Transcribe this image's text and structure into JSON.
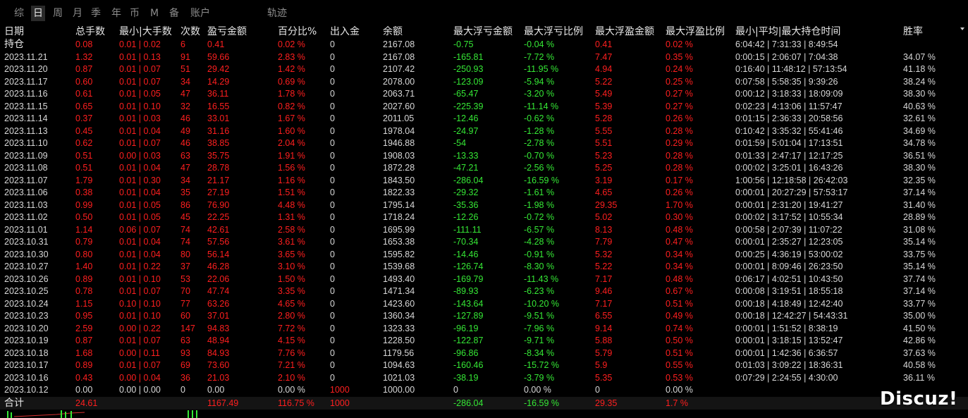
{
  "tabs": [
    {
      "label": "综"
    },
    {
      "label": "日"
    },
    {
      "label": "周"
    },
    {
      "label": "月"
    },
    {
      "label": "季"
    },
    {
      "label": "年"
    },
    {
      "label": "币"
    },
    {
      "label": "M"
    },
    {
      "label": "备"
    },
    {
      "label": "账户"
    },
    {
      "label": "轨迹"
    }
  ],
  "active_tab": "日",
  "columns": [
    "日期",
    "总手数",
    "最小|大手数",
    "次数",
    "盈亏金额",
    "百分比%",
    "出入金",
    "余额",
    "最大浮亏金额",
    "最大浮亏比例",
    "最大浮盈金额",
    "最大浮盈比例",
    "最小|平均|最大持仓时间",
    "胜率"
  ],
  "colors": {
    "positive": "#ff1f1f",
    "negative": "#35e835",
    "neutral": "#d8d8d8",
    "background": "#000000"
  },
  "rows": [
    [
      "持仓",
      "0.08",
      "0.01 | 0.02",
      "6",
      "0.41",
      "0.02 %",
      "0",
      "2167.08",
      "-0.75",
      "-0.04 %",
      "0.41",
      "0.02 %",
      "6:04:42 | 7:31:33 | 8:49:54",
      ""
    ],
    [
      "2023.11.21",
      "1.32",
      "0.01 | 0.13",
      "91",
      "59.66",
      "2.83 %",
      "0",
      "2167.08",
      "-165.81",
      "-7.72 %",
      "7.47",
      "0.35 %",
      "0:00:15 | 2:06:07 | 7:04:38",
      "34.07 %"
    ],
    [
      "2023.11.20",
      "0.87",
      "0.01 | 0.07",
      "51",
      "29.42",
      "1.42 %",
      "0",
      "2107.42",
      "-250.93",
      "-11.95 %",
      "4.94",
      "0.24 %",
      "0:16:40 | 11:48:12 | 57:13:54",
      "41.18 %"
    ],
    [
      "2023.11.17",
      "0.60",
      "0.01 | 0.07",
      "34",
      "14.29",
      "0.69 %",
      "0",
      "2078.00",
      "-123.09",
      "-5.94 %",
      "5.22",
      "0.25 %",
      "0:07:58 | 5:58:35 | 9:39:26",
      "38.24 %"
    ],
    [
      "2023.11.16",
      "0.61",
      "0.01 | 0.05",
      "47",
      "36.11",
      "1.78 %",
      "0",
      "2063.71",
      "-65.47",
      "-3.20 %",
      "5.49",
      "0.27 %",
      "0:00:12 | 3:18:33 | 18:09:09",
      "38.30 %"
    ],
    [
      "2023.11.15",
      "0.65",
      "0.01 | 0.10",
      "32",
      "16.55",
      "0.82 %",
      "0",
      "2027.60",
      "-225.39",
      "-11.14 %",
      "5.39",
      "0.27 %",
      "0:02:23 | 4:13:06 | 11:57:47",
      "40.63 %"
    ],
    [
      "2023.11.14",
      "0.37",
      "0.01 | 0.03",
      "46",
      "33.01",
      "1.67 %",
      "0",
      "2011.05",
      "-12.46",
      "-0.62 %",
      "5.28",
      "0.26 %",
      "0:01:15 | 2:36:33 | 20:58:56",
      "32.61 %"
    ],
    [
      "2023.11.13",
      "0.45",
      "0.01 | 0.04",
      "49",
      "31.16",
      "1.60 %",
      "0",
      "1978.04",
      "-24.97",
      "-1.28 %",
      "5.55",
      "0.28 %",
      "0:10:42 | 3:35:32 | 55:41:46",
      "34.69 %"
    ],
    [
      "2023.11.10",
      "0.62",
      "0.01 | 0.07",
      "46",
      "38.85",
      "2.04 %",
      "0",
      "1946.88",
      "-54",
      "-2.78 %",
      "5.51",
      "0.29 %",
      "0:01:59 | 5:01:04 | 17:13:51",
      "34.78 %"
    ],
    [
      "2023.11.09",
      "0.51",
      "0.00 | 0.03",
      "63",
      "35.75",
      "1.91 %",
      "0",
      "1908.03",
      "-13.33",
      "-0.70 %",
      "5.23",
      "0.28 %",
      "0:01:33 | 2:47:17 | 12:17:25",
      "36.51 %"
    ],
    [
      "2023.11.08",
      "0.51",
      "0.01 | 0.04",
      "47",
      "28.78",
      "1.56 %",
      "0",
      "1872.28",
      "-47.21",
      "-2.56 %",
      "5.25",
      "0.28 %",
      "0:00:02 | 3:25:01 | 16:43:26",
      "38.30 %"
    ],
    [
      "2023.11.07",
      "1.79",
      "0.01 | 0.30",
      "34",
      "21.17",
      "1.16 %",
      "0",
      "1843.50",
      "-286.04",
      "-16.59 %",
      "3.19",
      "0.17 %",
      "1:00:56 | 12:18:58 | 26:42:03",
      "32.35 %"
    ],
    [
      "2023.11.06",
      "0.38",
      "0.01 | 0.04",
      "35",
      "27.19",
      "1.51 %",
      "0",
      "1822.33",
      "-29.32",
      "-1.61 %",
      "4.65",
      "0.26 %",
      "0:00:01 | 20:27:29 | 57:53:17",
      "37.14 %"
    ],
    [
      "2023.11.03",
      "0.99",
      "0.01 | 0.05",
      "86",
      "76.90",
      "4.48 %",
      "0",
      "1795.14",
      "-35.36",
      "-1.98 %",
      "29.35",
      "1.70 %",
      "0:00:01 | 2:31:20 | 19:41:27",
      "31.40 %"
    ],
    [
      "2023.11.02",
      "0.50",
      "0.01 | 0.05",
      "45",
      "22.25",
      "1.31 %",
      "0",
      "1718.24",
      "-12.26",
      "-0.72 %",
      "5.02",
      "0.30 %",
      "0:00:02 | 3:17:52 | 10:55:34",
      "28.89 %"
    ],
    [
      "2023.11.01",
      "1.14",
      "0.06 | 0.07",
      "74",
      "42.61",
      "2.58 %",
      "0",
      "1695.99",
      "-111.11",
      "-6.57 %",
      "8.13",
      "0.48 %",
      "0:00:58 | 2:07:39 | 11:07:22",
      "31.08 %"
    ],
    [
      "2023.10.31",
      "0.79",
      "0.01 | 0.04",
      "74",
      "57.56",
      "3.61 %",
      "0",
      "1653.38",
      "-70.34",
      "-4.28 %",
      "7.79",
      "0.47 %",
      "0:00:01 | 2:35:27 | 12:23:05",
      "35.14 %"
    ],
    [
      "2023.10.30",
      "0.80",
      "0.01 | 0.04",
      "80",
      "56.14",
      "3.65 %",
      "0",
      "1595.82",
      "-14.46",
      "-0.91 %",
      "5.32",
      "0.34 %",
      "0:00:25 | 4:36:19 | 53:00:02",
      "33.75 %"
    ],
    [
      "2023.10.27",
      "1.40",
      "0.01 | 0.22",
      "37",
      "46.28",
      "3.10 %",
      "0",
      "1539.68",
      "-126.74",
      "-8.30 %",
      "5.22",
      "0.34 %",
      "0:00:01 | 8:09:46 | 26:23:50",
      "35.14 %"
    ],
    [
      "2023.10.26",
      "0.89",
      "0.01 | 0.10",
      "53",
      "22.06",
      "1.50 %",
      "0",
      "1493.40",
      "-169.79",
      "-11.43 %",
      "7.17",
      "0.48 %",
      "0:06:17 | 4:02:51 | 10:43:50",
      "37.74 %"
    ],
    [
      "2023.10.25",
      "0.78",
      "0.01 | 0.07",
      "70",
      "47.74",
      "3.35 %",
      "0",
      "1471.34",
      "-89.93",
      "-6.23 %",
      "9.46",
      "0.67 %",
      "0:00:08 | 3:19:51 | 18:55:18",
      "37.14 %"
    ],
    [
      "2023.10.24",
      "1.15",
      "0.10 | 0.10",
      "77",
      "63.26",
      "4.65 %",
      "0",
      "1423.60",
      "-143.64",
      "-10.20 %",
      "7.17",
      "0.51 %",
      "0:00:18 | 4:18:49 | 12:42:40",
      "33.77 %"
    ],
    [
      "2023.10.23",
      "0.95",
      "0.01 | 0.10",
      "60",
      "37.01",
      "2.80 %",
      "0",
      "1360.34",
      "-127.89",
      "-9.51 %",
      "6.55",
      "0.49 %",
      "0:00:18 | 12:42:27 | 54:43:31",
      "35.00 %"
    ],
    [
      "2023.10.20",
      "2.59",
      "0.00 | 0.22",
      "147",
      "94.83",
      "7.72 %",
      "0",
      "1323.33",
      "-96.19",
      "-7.96 %",
      "9.14",
      "0.74 %",
      "0:00:01 | 1:51:52 | 8:38:19",
      "41.50 %"
    ],
    [
      "2023.10.19",
      "0.87",
      "0.01 | 0.07",
      "63",
      "48.94",
      "4.15 %",
      "0",
      "1228.50",
      "-122.87",
      "-9.71 %",
      "5.88",
      "0.50 %",
      "0:00:01 | 3:18:15 | 13:52:47",
      "42.86 %"
    ],
    [
      "2023.10.18",
      "1.68",
      "0.00 | 0.11",
      "93",
      "84.93",
      "7.76 %",
      "0",
      "1179.56",
      "-96.86",
      "-8.34 %",
      "5.79",
      "0.51 %",
      "0:00:01 | 1:42:36 | 6:36:57",
      "37.63 %"
    ],
    [
      "2023.10.17",
      "0.89",
      "0.01 | 0.07",
      "69",
      "73.60",
      "7.21 %",
      "0",
      "1094.63",
      "-160.46",
      "-15.72 %",
      "5.9",
      "0.55 %",
      "0:01:03 | 3:09:22 | 18:36:31",
      "40.58 %"
    ],
    [
      "2023.10.16",
      "0.43",
      "0.00 | 0.04",
      "36",
      "21.03",
      "2.10 %",
      "0",
      "1021.03",
      "-38.19",
      "-3.79 %",
      "5.35",
      "0.53 %",
      "0:07:29 | 2:24:55 | 4:30:00",
      "36.11 %"
    ],
    [
      "2023.10.12",
      "0.00",
      "0.00 | 0.00",
      "0",
      "0.00",
      "0.00 %",
      "1000",
      "1000.00",
      "0",
      "0.00 %",
      "0",
      "0.00 %",
      "",
      ""
    ]
  ],
  "total": [
    "合计",
    "24.61",
    "",
    "",
    "1167.49",
    "116.75 %",
    "1000",
    "",
    "-286.04",
    "-16.59 %",
    "29.35",
    "1.7 %",
    "",
    ""
  ],
  "watermark": "Discuz!"
}
